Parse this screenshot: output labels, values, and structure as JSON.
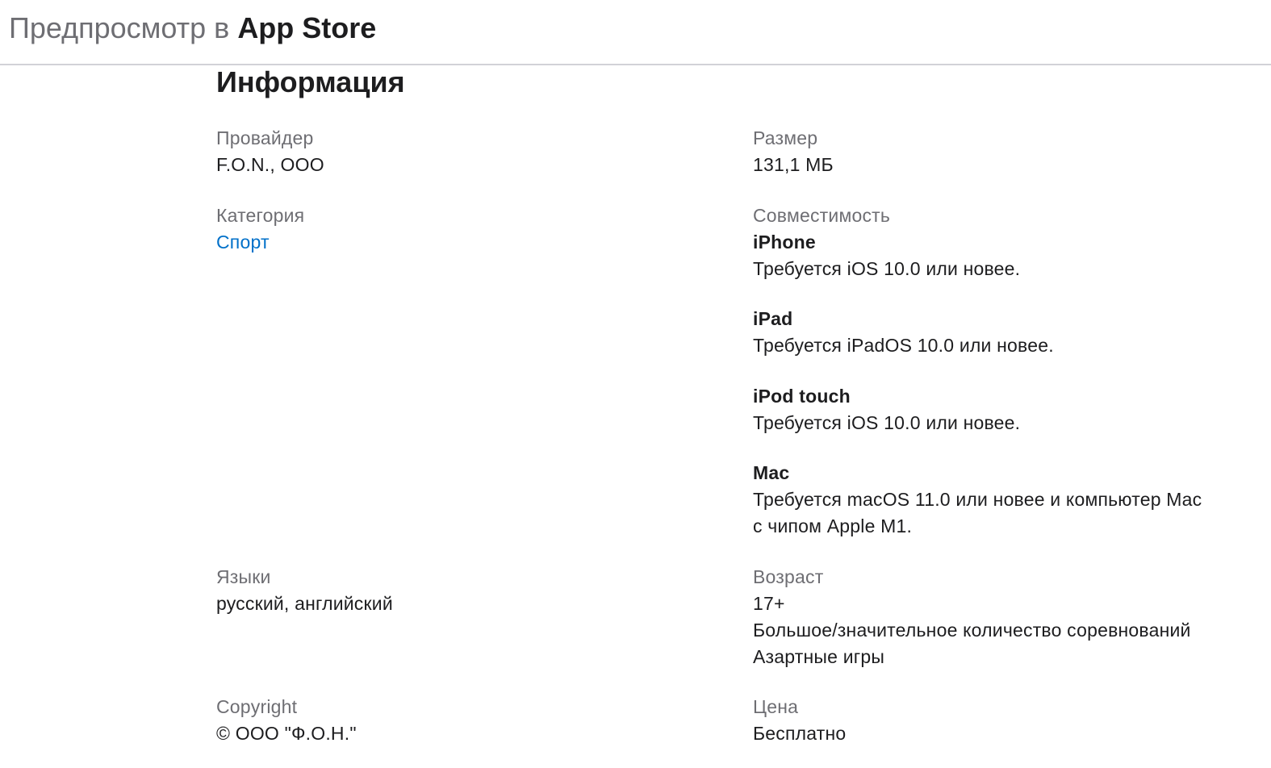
{
  "header": {
    "prefix": "Предпросмотр в",
    "brand": "App Store"
  },
  "section": {
    "title": "Информация"
  },
  "info": {
    "provider": {
      "label": "Провайдер",
      "value": "F.O.N., ООО"
    },
    "category": {
      "label": "Категория",
      "value": "Спорт"
    },
    "languages": {
      "label": "Языки",
      "value": "русский, английский"
    },
    "copyright": {
      "label": "Copyright",
      "value": "© ООО \"Ф.О.Н.\""
    },
    "size": {
      "label": "Размер",
      "value": "131,1 МБ"
    },
    "compatibility": {
      "label": "Совместимость",
      "devices": [
        {
          "name": "iPhone",
          "requirement": "Требуется iOS 10.0 или новее."
        },
        {
          "name": "iPad",
          "requirement": "Требуется iPadOS 10.0 или новее."
        },
        {
          "name": "iPod touch",
          "requirement": "Требуется iOS 10.0 или новее."
        },
        {
          "name": "Mac",
          "requirement": "Требуется macOS 11.0 или новее и компьютер Mac",
          "requirement_line2": "с чипом Apple M1."
        }
      ]
    },
    "age": {
      "label": "Возраст",
      "value": "17+",
      "details": [
        "Большое/значительное количество соревнований",
        "Азартные игры"
      ]
    },
    "price": {
      "label": "Цена",
      "value": "Бесплатно"
    }
  },
  "colors": {
    "link": "#0070c9",
    "label": "#6e6e73",
    "text": "#1d1d1f",
    "divider": "#d2d2d7"
  }
}
